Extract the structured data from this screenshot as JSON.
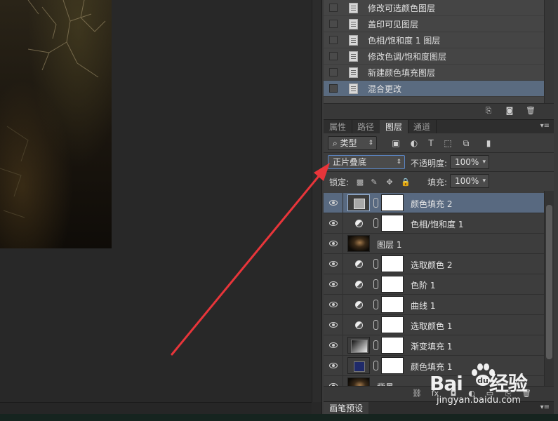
{
  "history": {
    "items": [
      {
        "label": "修改可选颜色图层",
        "selected": false
      },
      {
        "label": "盖印可见图层",
        "selected": false
      },
      {
        "label": "色相/饱和度 1 图层",
        "selected": false
      },
      {
        "label": "修改色调/饱和度图层",
        "selected": false
      },
      {
        "label": "新建颜色填充图层",
        "selected": false
      },
      {
        "label": "混合更改",
        "selected": true
      }
    ]
  },
  "tabs": [
    {
      "label": "属性",
      "active": false
    },
    {
      "label": "路径",
      "active": false
    },
    {
      "label": "图层",
      "active": true
    },
    {
      "label": "通道",
      "active": false
    }
  ],
  "layer_controls": {
    "filter_kind": "类型",
    "blend_mode": "正片叠底",
    "opacity_label": "不透明度:",
    "opacity_value": "100%",
    "lock_label": "锁定:",
    "fill_label": "填充:",
    "fill_value": "100%"
  },
  "layers": [
    {
      "name": "颜色填充 2",
      "thumb": "gray-fill",
      "has_mask": true,
      "selected": true
    },
    {
      "name": "色相/饱和度 1",
      "thumb": "adjustment",
      "has_mask": true,
      "selected": false
    },
    {
      "name": "图层 1",
      "thumb": "photo",
      "has_mask": false,
      "selected": false
    },
    {
      "name": "选取颜色 2",
      "thumb": "adjustment",
      "has_mask": true,
      "selected": false
    },
    {
      "name": "色阶 1",
      "thumb": "adjustment",
      "has_mask": true,
      "selected": false
    },
    {
      "name": "曲线 1",
      "thumb": "adjustment",
      "has_mask": true,
      "selected": false
    },
    {
      "name": "选取颜色 1",
      "thumb": "adjustment",
      "has_mask": true,
      "selected": false
    },
    {
      "name": "渐变填充 1",
      "thumb": "gradient",
      "has_mask": true,
      "selected": false
    },
    {
      "name": "颜色填充 1",
      "thumb": "navy-fill",
      "has_mask": true,
      "selected": false
    },
    {
      "name": "背景",
      "thumb": "photo",
      "has_mask": false,
      "selected": false
    }
  ],
  "brush_tab": {
    "label": "画笔预设"
  },
  "watermark": {
    "brand_left": "Bai",
    "brand_right": "经验",
    "site": "jingyan.baidu.com"
  },
  "colors": {
    "selection": "#586980",
    "panel": "#3d3d3d",
    "arrow": "#e8353a"
  }
}
